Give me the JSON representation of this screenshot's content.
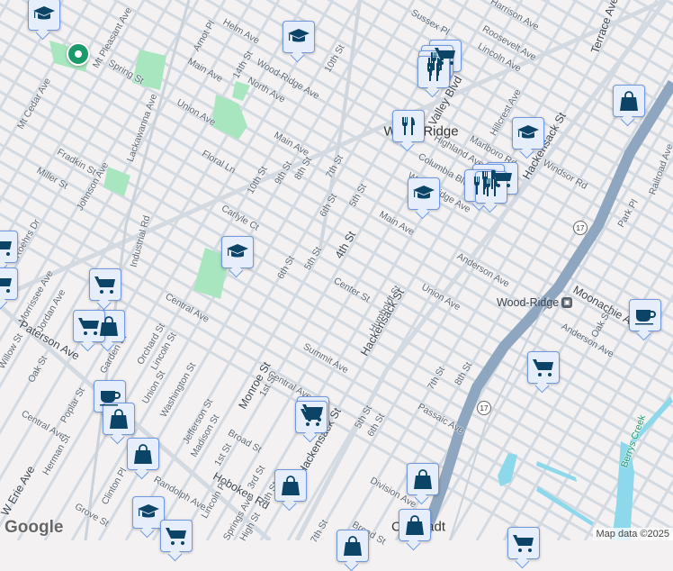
{
  "map": {
    "place_labels": {
      "wood_ridge": "Wood-Ridge",
      "carlstadt": "Carlstadt"
    },
    "station": {
      "name": "Wood-Ridge",
      "icon": "train-icon"
    },
    "highway_shield": "17",
    "creek": "Berrys Creek",
    "streets": {
      "helm": "Helm Ave",
      "arnot": "Arnot Pl",
      "mtpleasant": "Mt Pleasant Ave",
      "spring": "Spring St",
      "main1": "Main Ave",
      "s14": "14th St",
      "woodridge1": "Wood-Ridge Ave",
      "north": "North Ave",
      "s10a": "10th St",
      "mtcedar": "Mt Cedar Ave",
      "lackawanna": "Lackawanna Ave",
      "union1": "Union Ave",
      "main2": "Main Ave",
      "fradkin": "Fradkin St",
      "floral": "Floral Ln",
      "s10b": "10th St",
      "s9": "9th St",
      "s8": "8th St",
      "s7a": "7th St",
      "s6a": "6th St",
      "s5a": "5th St",
      "johnson": "Johnson Ave",
      "miller": "Miller St",
      "industrial": "Industrial Rd",
      "roehrs": "Roehrs Dr",
      "carlyle": "Carlyle Ct",
      "s6b": "6th St",
      "s5b": "5th St",
      "s4": "4th St",
      "main3": "Main Ave",
      "anderson1": "Anderson Ave",
      "center": "Center St",
      "humboldt": "Humboldt St",
      "hackensack1": "Hackensack St",
      "union2": "Union Ave",
      "central1": "Central Ave",
      "orchard": "Orchard St",
      "lincoln": "Lincoln St",
      "morrissee": "Morrissee Ave",
      "jordan": "Jordan Ave",
      "paterson": "Paterson Ave",
      "willow": "Willow St",
      "oak1": "Oak St",
      "garden": "Garden St",
      "summit": "Summit Ave",
      "monroe": "Monroe St",
      "central2": "Central Ave",
      "unionst": "Union St",
      "washington": "Washington St",
      "jefferson": "Jefferson St",
      "madison": "Madison St",
      "poplar": "Poplar St",
      "central3": "Central Ave",
      "s1a": "1st St",
      "broad1": "Broad St",
      "s1b": "1st St",
      "hackensack2": "Hackensack St",
      "s5c": "5th St",
      "s6c": "6th St",
      "s7b": "7th St",
      "s8b": "8th St",
      "passaic": "Passaic Ave",
      "herman": "Herman St",
      "werie": "W Erie Ave",
      "clinton": "Clinton Pl",
      "grove": "Grove St",
      "hoboken": "Hoboken Rd",
      "lincolnpl": "Lincoln Pl",
      "s3": "3rd St",
      "s4b": "4th St",
      "division": "Division Ave",
      "moonachie": "Moonachie Ave",
      "anderson2": "Anderson Ave",
      "oak2": "Oak St",
      "terrace": "Terrace Ave",
      "sussex": "Sussex Pl",
      "roosevelt": "Roosevelt Ave",
      "lincolnave": "Lincoln Ave",
      "harrison": "Harrison Ave",
      "valley": "Valley Blvd",
      "hillcrest": "Hillcrest Ave",
      "marlboro": "Marlboro Rd",
      "windsor": "Windsor Rd",
      "highland": "Highland Ave",
      "columbia": "Columbia Blvd",
      "woodridge2": "Wood-Ridge Ave",
      "hackensack3": "Hackensack St",
      "park": "Park Pl",
      "railroad": "Railroad Ave",
      "s7c": "7th St",
      "broad2": "Broad St",
      "randolph": "Randolph Ave",
      "springs": "Springs Ave",
      "high": "High St"
    },
    "colors": {
      "marker_icon": "#0b4467",
      "marker_bg": "#e6eefc",
      "marker_border": "#6f98e0",
      "park": "#a8e6c0",
      "water": "#8ed8ec",
      "highway": "#8fa6c0",
      "pin": "#1a9a6a"
    }
  },
  "attribution": {
    "logo": "Google",
    "text": "Map data ©2025"
  }
}
